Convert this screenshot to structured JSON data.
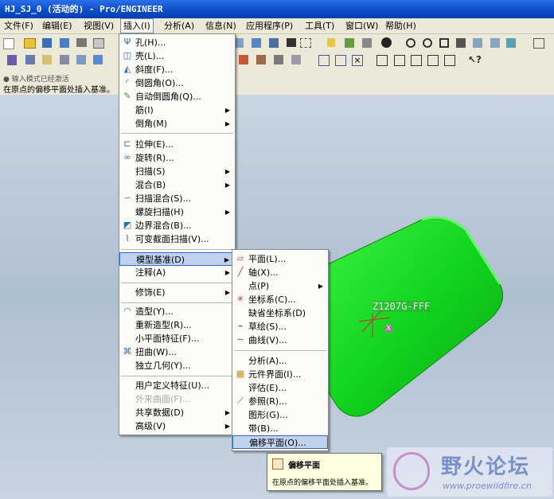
{
  "window": {
    "title": "HJ_SJ_0 (活动的) - Pro/ENGINEER"
  },
  "menubar": [
    {
      "label": "文件(F)"
    },
    {
      "label": "编辑(E)"
    },
    {
      "label": "视图(V)"
    },
    {
      "label": "插入(I)"
    },
    {
      "label": "分析(A)"
    },
    {
      "label": "信息(N)"
    },
    {
      "label": "应用程序(P)"
    },
    {
      "label": "工具(T)"
    },
    {
      "label": "窗口(W)"
    },
    {
      "label": "帮助(H)"
    }
  ],
  "message_area": {
    "line1": "● 输入模式已经激活",
    "line2": "在原点的偏移平面处插入基准。"
  },
  "insert_menu": [
    {
      "label": "孔(H)...",
      "icon": "hole-icon"
    },
    {
      "label": "壳(L)...",
      "icon": "shell-icon"
    },
    {
      "label": "斜度(F)...",
      "icon": "draft-icon"
    },
    {
      "label": "倒圆角(O)...",
      "icon": "round-icon"
    },
    {
      "label": "自动倒圆角(Q)...",
      "icon": "auto-round-icon"
    },
    {
      "label": "筋(I)"
    },
    {
      "label": "倒角(M)"
    },
    {
      "label": "拉伸(E)...",
      "icon": "extrude-icon"
    },
    {
      "label": "旋转(R)...",
      "icon": "revolve-icon"
    },
    {
      "label": "扫描(S)"
    },
    {
      "label": "混合(B)"
    },
    {
      "label": "扫描混合(S)...",
      "icon": "swept-blend-icon"
    },
    {
      "label": "螺旋扫描(H)"
    },
    {
      "label": "边界混合(B)...",
      "icon": "boundary-blend-icon"
    },
    {
      "label": "可变截面扫描(V)...",
      "icon": "variable-sweep-icon"
    },
    {
      "label": "模型基准(D)"
    },
    {
      "label": "注释(A)"
    },
    {
      "label": "修饰(E)"
    },
    {
      "label": "造型(Y)...",
      "icon": "style-icon"
    },
    {
      "label": "重新造型(R)..."
    },
    {
      "label": "小平面特征(F)..."
    },
    {
      "label": "扭曲(W)...",
      "icon": "warp-icon"
    },
    {
      "label": "独立几何(Y)..."
    },
    {
      "label": "用户定义特征(U)..."
    },
    {
      "label": "外来曲面(F)..."
    },
    {
      "label": "共享数据(D)"
    },
    {
      "label": "高级(V)"
    }
  ],
  "datum_menu": [
    {
      "label": "平面(L)...",
      "icon": "datum-plane-icon"
    },
    {
      "label": "轴(X)...",
      "icon": "datum-axis-icon"
    },
    {
      "label": "点(P)"
    },
    {
      "label": "坐标系(C)...",
      "icon": "csys-icon"
    },
    {
      "label": "缺省坐标系(D)"
    },
    {
      "label": "草绘(S)...",
      "icon": "sketch-icon"
    },
    {
      "label": "曲线(V)...",
      "icon": "curve-icon"
    },
    {
      "label": "分析(A)..."
    },
    {
      "label": "元件界面(I)...",
      "icon": "component-interface-icon"
    },
    {
      "label": "评估(E)..."
    },
    {
      "label": "参照(R)...",
      "icon": "reference-icon"
    },
    {
      "label": "图形(G)..."
    },
    {
      "label": "带(B)..."
    },
    {
      "label": "偏移平面(O)..."
    }
  ],
  "model": {
    "label": "Z1207G-FFF",
    "sublabel": "X"
  },
  "tooltip": {
    "title": "偏移平面",
    "text": "在原点的偏移平面处插入基准。"
  },
  "watermark": {
    "name": "野火论坛",
    "url": "www.proewildfire.cn"
  },
  "colors": {
    "model_green": "#12d41e",
    "highlight": "#c1d2ee",
    "menubar": "#ece9d8"
  }
}
